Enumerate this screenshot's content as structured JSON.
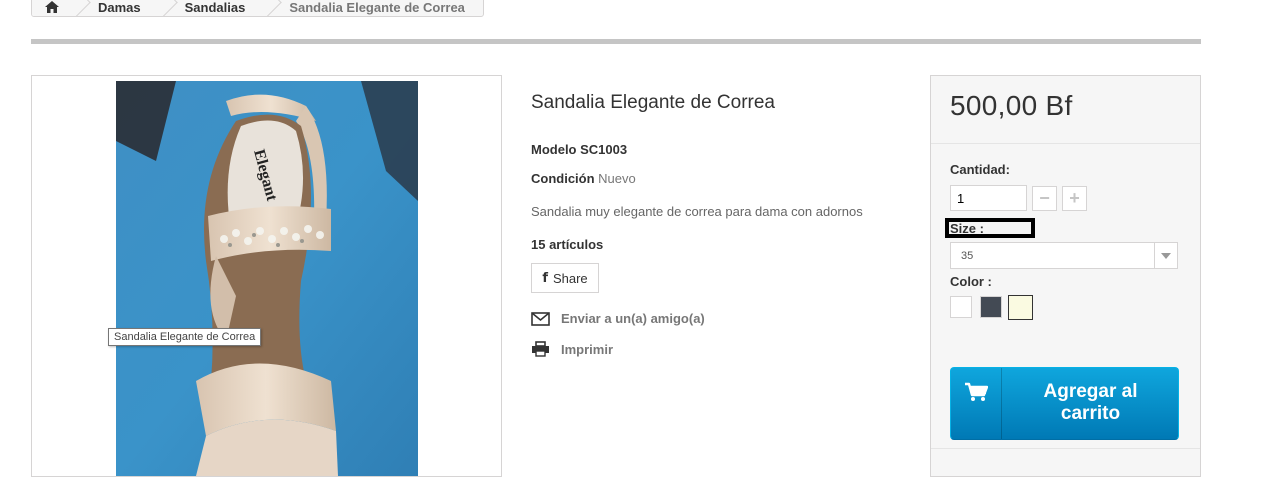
{
  "breadcrumb": {
    "items": [
      "Damas",
      "Sandalias",
      "Sandalia Elegante de Correa"
    ]
  },
  "image": {
    "tooltip": "Sandalia Elegante de Correa",
    "insole_brand": "Elegant"
  },
  "product": {
    "title": "Sandalia Elegante de Correa",
    "model_label": "Modelo",
    "model_value": "SC1003",
    "condition_label": "Condición",
    "condition_value": "Nuevo",
    "description": "Sandalia muy elegante de correa para dama con adornos",
    "stock": "15 artículos",
    "share_label": "Share",
    "send_friend_label": "Enviar a un(a) amigo(a)",
    "print_label": "Imprimir"
  },
  "buy": {
    "price": "500,00 Bf",
    "quantity_label": "Cantidad:",
    "quantity_value": "1",
    "size_label": "Size :",
    "size_selected": "35",
    "color_label": "Color :",
    "colors": [
      "#ffffff",
      "#434a54",
      "#fafae1"
    ],
    "add_to_cart_line1": "Agregar al",
    "add_to_cart_line2": "carrito"
  },
  "colors": {
    "accent": "#0a92cf",
    "border": "#d6d4d4",
    "panel": "#f6f6f6"
  }
}
